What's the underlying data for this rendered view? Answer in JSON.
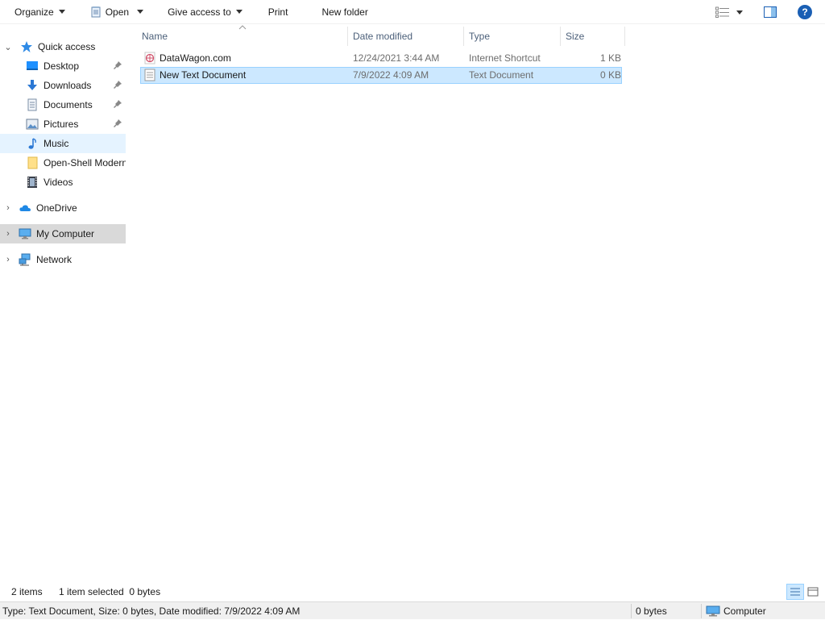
{
  "toolbar": {
    "organize": "Organize",
    "open": "Open",
    "give_access": "Give access to",
    "print": "Print",
    "new_folder": "New folder",
    "help": "?"
  },
  "nav": {
    "quick_access": "Quick access",
    "items": [
      {
        "label": "Desktop",
        "icon": "desktop-icon",
        "pinned": true
      },
      {
        "label": "Downloads",
        "icon": "downloads-icon",
        "pinned": true
      },
      {
        "label": "Documents",
        "icon": "documents-icon",
        "pinned": true
      },
      {
        "label": "Pictures",
        "icon": "pictures-icon",
        "pinned": true
      },
      {
        "label": "Music",
        "icon": "music-icon",
        "pinned": false
      },
      {
        "label": "Open-Shell Modern",
        "icon": "folder-icon",
        "pinned": false
      },
      {
        "label": "Videos",
        "icon": "videos-icon",
        "pinned": false
      }
    ],
    "onedrive": "OneDrive",
    "my_computer": "My Computer",
    "network": "Network"
  },
  "columns": {
    "name": "Name",
    "date_modified": "Date modified",
    "type": "Type",
    "size": "Size"
  },
  "files": [
    {
      "name": "DataWagon.com",
      "date": "12/24/2021 3:44 AM",
      "type": "Internet Shortcut",
      "size": "1 KB",
      "icon": "internet-shortcut-icon"
    },
    {
      "name": "New Text Document",
      "date": "7/9/2022 4:09 AM",
      "type": "Text Document",
      "size": "0 KB",
      "icon": "text-document-icon"
    }
  ],
  "status": {
    "item_count": "2 items",
    "selection": "1 item selected  0 bytes",
    "details": "Type: Text Document, Size: 0 bytes, Date modified: 7/9/2022 4:09 AM",
    "bytes": "0 bytes",
    "location": "Computer"
  },
  "colors": {
    "selection_bg": "#cce8ff",
    "selection_border": "#99d1ff",
    "hover_bg": "#e5f3ff",
    "accent": "#1a5fb4"
  }
}
